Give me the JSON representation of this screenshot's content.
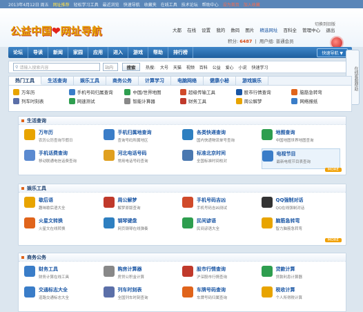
{
  "topbar": {
    "items": [
      "2013年4月12日 周五",
      "网址推荐",
      "轻松学习工具",
      "最近浏览",
      "快速导航",
      "收藏夹",
      "在线工具",
      "技术论坛",
      "帮助中心",
      "设为首页",
      "加入收藏"
    ]
  },
  "header": {
    "logo_text_1": "公益中国",
    "logo_heart": "❤",
    "logo_text_2": "网址导航",
    "links": [
      "大都",
      "在线",
      "设置",
      "我的",
      "数码",
      "图片",
      "精选网址",
      "百科全",
      "管理中心",
      "退出"
    ],
    "right_top": "切换到旧版",
    "sub_label": "积分:",
    "sub_points": "6487",
    "sub_extra": "用户组:",
    "sub_group": "普通会员"
  },
  "nav": {
    "items": [
      "论坛",
      "导读",
      "新闻",
      "家园",
      "应用",
      "进入",
      "游戏",
      "帮助",
      "排行榜"
    ],
    "extra": "快速导航 ▼"
  },
  "search": {
    "placeholder": "请输入搜索内容",
    "select": "站内",
    "button": "搜索",
    "hot_label": "热搜:",
    "hot": [
      "大号",
      "天猫",
      "视频",
      "百科",
      "公益",
      "爱心",
      "小说",
      "快速学习"
    ]
  },
  "side_float": "在线客服帮助",
  "tabs": {
    "items": [
      "热门工具",
      "生活查询",
      "娱乐工具",
      "商务公务",
      "计算学习",
      "电脑网络",
      "健康小秘",
      "游戏娱乐"
    ],
    "quick": [
      {
        "label": "万年历",
        "color": "#e8a400"
      },
      {
        "label": "手机号码归属查询",
        "color": "#3a7dc8"
      },
      {
        "label": "中国/世界地图",
        "color": "#2e9e4f"
      },
      {
        "label": "超级传输工具",
        "color": "#d04a2a"
      },
      {
        "label": "股市行情查询",
        "color": "#1a56a4"
      },
      {
        "label": "脑筋急转弯",
        "color": "#e0641b"
      },
      {
        "label": "列车时刻表",
        "color": "#5b6fa8"
      },
      {
        "label": "网速测试",
        "color": "#2e9e4f"
      },
      {
        "label": "智能计算器",
        "color": "#888888"
      },
      {
        "label": "财务工具",
        "color": "#c0392b"
      },
      {
        "label": "周公解梦",
        "color": "#e8a400"
      },
      {
        "label": "网络报纸",
        "color": "#3a7dc8"
      }
    ]
  },
  "sections": [
    {
      "title": "生活查询",
      "items": [
        {
          "name": "万年历",
          "desc": "农历公历查询节假日",
          "color": "#e8a400"
        },
        {
          "name": "手机归属地查询",
          "desc": "查询号码所属地区",
          "color": "#3a7dc8"
        },
        {
          "name": "各类快递查询",
          "desc": "国内快递物流单号查询",
          "color": "#2e7fc0"
        },
        {
          "name": "地图查询",
          "desc": "中国地图世界地图查询",
          "color": "#2e9e4f"
        },
        {
          "name": "手机话费查询",
          "desc": "移动联通电信话费查询",
          "color": "#5b8ad0"
        },
        {
          "name": "河北电话号码",
          "desc": "常用电话号码查询",
          "color": "#e0a020"
        },
        {
          "name": "标准北京时间",
          "desc": "全国标准时间校对",
          "color": "#4a78b0"
        },
        {
          "name": "电视节目",
          "desc": "最新电视节目表查询",
          "color": "#3a7dc8",
          "hl": true
        }
      ]
    },
    {
      "title": "娱乐工具",
      "items": [
        {
          "name": "歇后语",
          "desc": "趣味歇后语大全",
          "color": "#e8a400"
        },
        {
          "name": "周公解梦",
          "desc": "解梦原版查询",
          "color": "#c0392b"
        },
        {
          "name": "手机号码吉凶",
          "desc": "手机号码吉凶测试",
          "color": "#d04a2a"
        },
        {
          "name": "QQ强制对话",
          "desc": "QQ在线强制对话",
          "color": "#333333"
        },
        {
          "name": "火星文转换",
          "desc": "火星文在线转换",
          "color": "#e0641b"
        },
        {
          "name": "钢琴键盘",
          "desc": "网页钢琴在线弹奏",
          "color": "#2e7fc0"
        },
        {
          "name": "民间谚语",
          "desc": "民间谚语大全",
          "color": "#2e9e4f"
        },
        {
          "name": "脑筋急转弯",
          "desc": "智力脑筋急转弯",
          "color": "#e8a400"
        }
      ]
    },
    {
      "title": "商务公务",
      "items": [
        {
          "name": "财务工具",
          "desc": "财务计算在线工具",
          "color": "#3a7dc8"
        },
        {
          "name": "购房计算器",
          "desc": "房贷公积金计算",
          "color": "#888888"
        },
        {
          "name": "股市行情查询",
          "desc": "沪深股市行情查询",
          "color": "#c0392b"
        },
        {
          "name": "贷款计算",
          "desc": "贷款利息计算器",
          "color": "#2e9e4f"
        },
        {
          "name": "交通标志大全",
          "desc": "道路交通标志大全",
          "color": "#3a7dc8"
        },
        {
          "name": "列车时刻表",
          "desc": "全国列车时刻查询",
          "color": "#5b6fa8"
        },
        {
          "name": "车牌号码查询",
          "desc": "车牌号码归属查询",
          "color": "#e0641b"
        },
        {
          "name": "税收计算",
          "desc": "个人所得税计算",
          "color": "#e8a400"
        }
      ]
    }
  ],
  "more_label": "MORE"
}
